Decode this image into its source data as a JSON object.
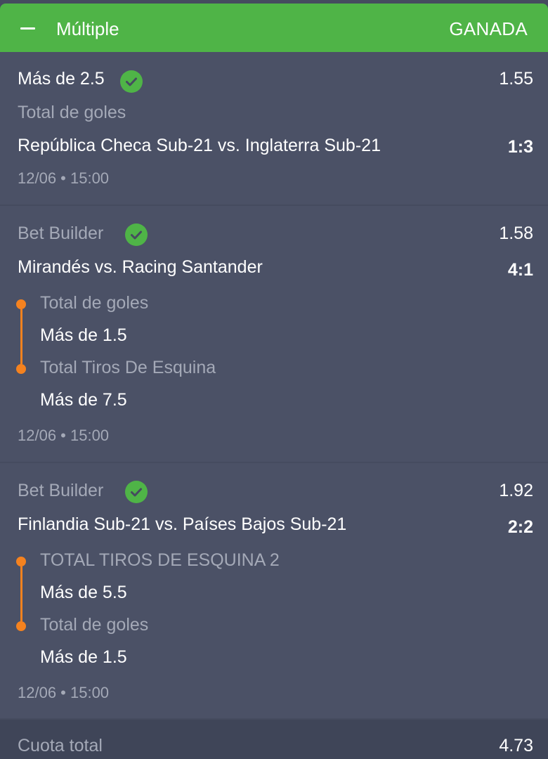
{
  "header": {
    "title": "Múltiple",
    "status": "GANADA",
    "collapse_icon": "minus-icon",
    "color": "#4fb447"
  },
  "selections": [
    {
      "market": "Más de 2.5",
      "odds": "1.55",
      "market_type": "Total de goles",
      "match": "República Checa Sub-21 vs. Inglaterra Sub-21",
      "score": "1:3",
      "datetime": "12/06 • 15:00",
      "status_icon": "check-circle-icon"
    },
    {
      "market": "Bet Builder",
      "odds": "1.58",
      "match": "Mirandés vs. Racing Santander",
      "score": "4:1",
      "legs": [
        {
          "market": "Total de goles",
          "selection": "Más de 1.5"
        },
        {
          "market": "Total Tiros De Esquina",
          "selection": "Más de 7.5"
        }
      ],
      "datetime": "12/06 • 15:00",
      "status_icon": "check-circle-icon"
    },
    {
      "market": "Bet Builder",
      "odds": "1.92",
      "match": "Finlandia Sub-21 vs. Países Bajos Sub-21",
      "score": "2:2",
      "legs": [
        {
          "market": "TOTAL TIROS DE ESQUINA 2",
          "selection": "Más de 5.5"
        },
        {
          "market": "Total de goles",
          "selection": "Más de 1.5"
        }
      ],
      "datetime": "12/06 • 15:00",
      "status_icon": "check-circle-icon"
    }
  ],
  "total": {
    "label": "Cuota total",
    "value": "4.73"
  },
  "colors": {
    "win": "#4fb447",
    "leg_marker": "#f5821f",
    "card_bg": "#4b5166"
  }
}
